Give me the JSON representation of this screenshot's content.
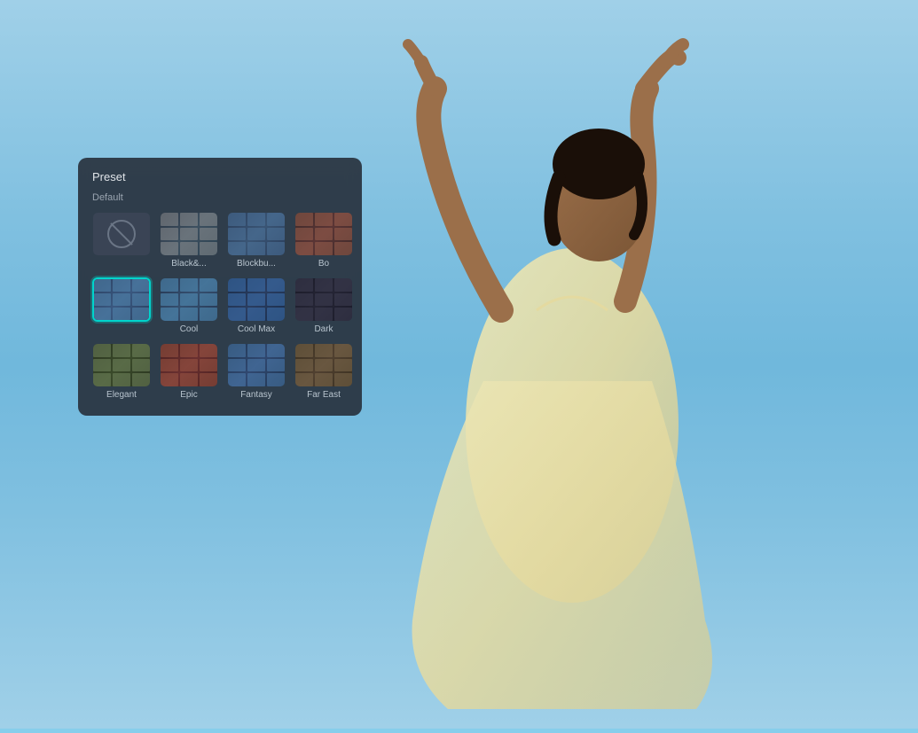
{
  "panel": {
    "title": "Preset",
    "section_label": "Default",
    "colors": {
      "panel_bg": "rgba(40, 50, 62, 0.92)",
      "selected_border": "#00d4cc",
      "text_primary": "#e0e4e8",
      "text_secondary": "#9aa4b0",
      "text_label": "#b8c4ce"
    }
  },
  "presets": {
    "row1": [
      {
        "id": "none",
        "label": "",
        "type": "default",
        "selected": false
      },
      {
        "id": "black-white",
        "label": "Black&...",
        "type": "bw",
        "selected": false
      },
      {
        "id": "blockbuster",
        "label": "Blockbu...",
        "type": "blue-tint",
        "selected": false
      },
      {
        "id": "bo",
        "label": "Bo",
        "type": "warm",
        "selected": false
      }
    ],
    "row2": [
      {
        "id": "selected-preset",
        "label": "",
        "type": "selected-thumb",
        "selected": true
      },
      {
        "id": "cool",
        "label": "Cool",
        "type": "cool-tint",
        "selected": false
      },
      {
        "id": "cool-max",
        "label": "Cool Max",
        "type": "cool-max",
        "selected": false
      },
      {
        "id": "dark",
        "label": "Dark",
        "type": "dark",
        "selected": false
      }
    ],
    "row3": [
      {
        "id": "elegant",
        "label": "Elegant",
        "type": "elegant",
        "selected": false
      },
      {
        "id": "epic",
        "label": "Epic",
        "type": "epic",
        "selected": false
      },
      {
        "id": "fantasy",
        "label": "Fantasy",
        "type": "fantasy",
        "selected": false
      },
      {
        "id": "far-east",
        "label": "Far East",
        "type": "far-east",
        "selected": false
      }
    ]
  }
}
